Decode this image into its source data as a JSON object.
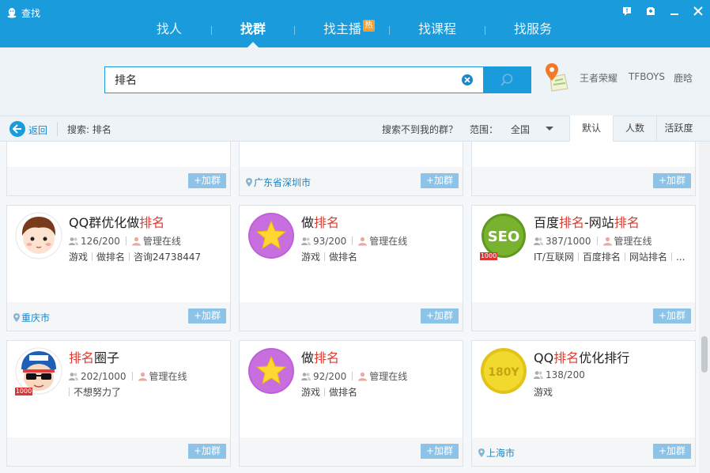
{
  "window": {
    "title": "查找",
    "buttons": [
      "feedback",
      "skin",
      "minimize",
      "close"
    ]
  },
  "nav": {
    "tabs": [
      {
        "label": "找人",
        "active": false
      },
      {
        "label": "找群",
        "active": true
      },
      {
        "label": "找主播",
        "active": false,
        "badge": "热"
      },
      {
        "label": "找课程",
        "active": false
      },
      {
        "label": "找服务",
        "active": false
      }
    ]
  },
  "search": {
    "value": "排名",
    "hot_tags": [
      "王者荣耀",
      "TFBOYS",
      "鹿晗"
    ]
  },
  "toolbar": {
    "back_label": "返回",
    "search_status": "搜索: 排名",
    "not_found_link": "搜索不到我的群？",
    "range_label": "范围：",
    "range_value": "全国",
    "sort_tabs": [
      {
        "label": "默认",
        "active": true
      },
      {
        "label": "人数",
        "active": false
      },
      {
        "label": "活跃度",
        "active": false
      }
    ]
  },
  "add_button_label": "+加群",
  "top_partial_cards": [
    {
      "location": ""
    },
    {
      "location": "广东省深圳市"
    },
    {
      "location": ""
    }
  ],
  "groups": [
    {
      "name_parts": [
        "QQ群优化做",
        "排名",
        ""
      ],
      "members": "126/200",
      "admin": "管理在线",
      "tags": [
        "游戏",
        "做排名",
        "咨询24738447"
      ],
      "location": "重庆市",
      "avatar": "cartoon-boy",
      "level": ""
    },
    {
      "name_parts": [
        "做",
        "排名",
        ""
      ],
      "members": "93/200",
      "admin": "管理在线",
      "tags": [
        "游戏",
        "做排名"
      ],
      "location": "",
      "avatar": "star",
      "level": ""
    },
    {
      "name_parts": [
        "百度",
        "排名",
        "-网站",
        "排名",
        ""
      ],
      "members": "387/1000",
      "admin": "管理在线",
      "tags": [
        "IT/互联网",
        "百度排名",
        "网站排名",
        "..."
      ],
      "location": "",
      "avatar": "seo",
      "level": "1000"
    },
    {
      "name_parts": [
        "",
        "排名",
        "圈子"
      ],
      "members": "202/1000",
      "admin": "管理在线",
      "tags": [
        "不想努力了"
      ],
      "location": "",
      "avatar": "cap-boy",
      "level": "1000"
    },
    {
      "name_parts": [
        "做",
        "排名",
        ""
      ],
      "members": "92/200",
      "admin": "管理在线",
      "tags": [
        "游戏",
        "做排名"
      ],
      "location": "",
      "avatar": "star",
      "level": ""
    },
    {
      "name_parts": [
        "QQ",
        "排名",
        "优化排行"
      ],
      "members": "138/200",
      "admin": "",
      "tags": [
        "游戏"
      ],
      "location": "上海市",
      "avatar": "coin",
      "level": ""
    }
  ],
  "avatar_texts": {
    "seo": "SEO",
    "coin": "180Y"
  }
}
